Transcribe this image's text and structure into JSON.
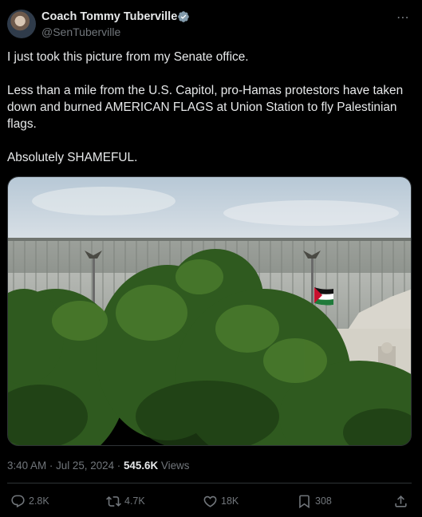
{
  "author": {
    "name": "Coach Tommy Tuberville",
    "handle": "@SenTuberville",
    "verified_color": "#829aab"
  },
  "more_icon": "⋯",
  "tweet": {
    "text": "I just took this picture from my Senate office.\n\nLess than a mile from the U.S. Capitol, pro-Hamas protestors have taken down and burned AMERICAN FLAGS at Union Station to fly Palestinian flags.\n\nAbsolutely SHAMEFUL."
  },
  "meta": {
    "time": "3:40 AM",
    "separator": "·",
    "date": "Jul 25, 2024",
    "views_count": "545.6K",
    "views_label": "Views"
  },
  "actions": {
    "replies": "2.8K",
    "reposts": "4.7K",
    "likes": "18K",
    "bookmarks": "308"
  },
  "icons": [
    "reply-icon",
    "repost-icon",
    "like-icon",
    "bookmark-icon",
    "share-icon",
    "verified-badge-icon",
    "more-icon"
  ],
  "colors": {
    "background": "#000000",
    "text": "#e7e9ea",
    "secondary": "#71767b",
    "border": "#2f3336"
  }
}
